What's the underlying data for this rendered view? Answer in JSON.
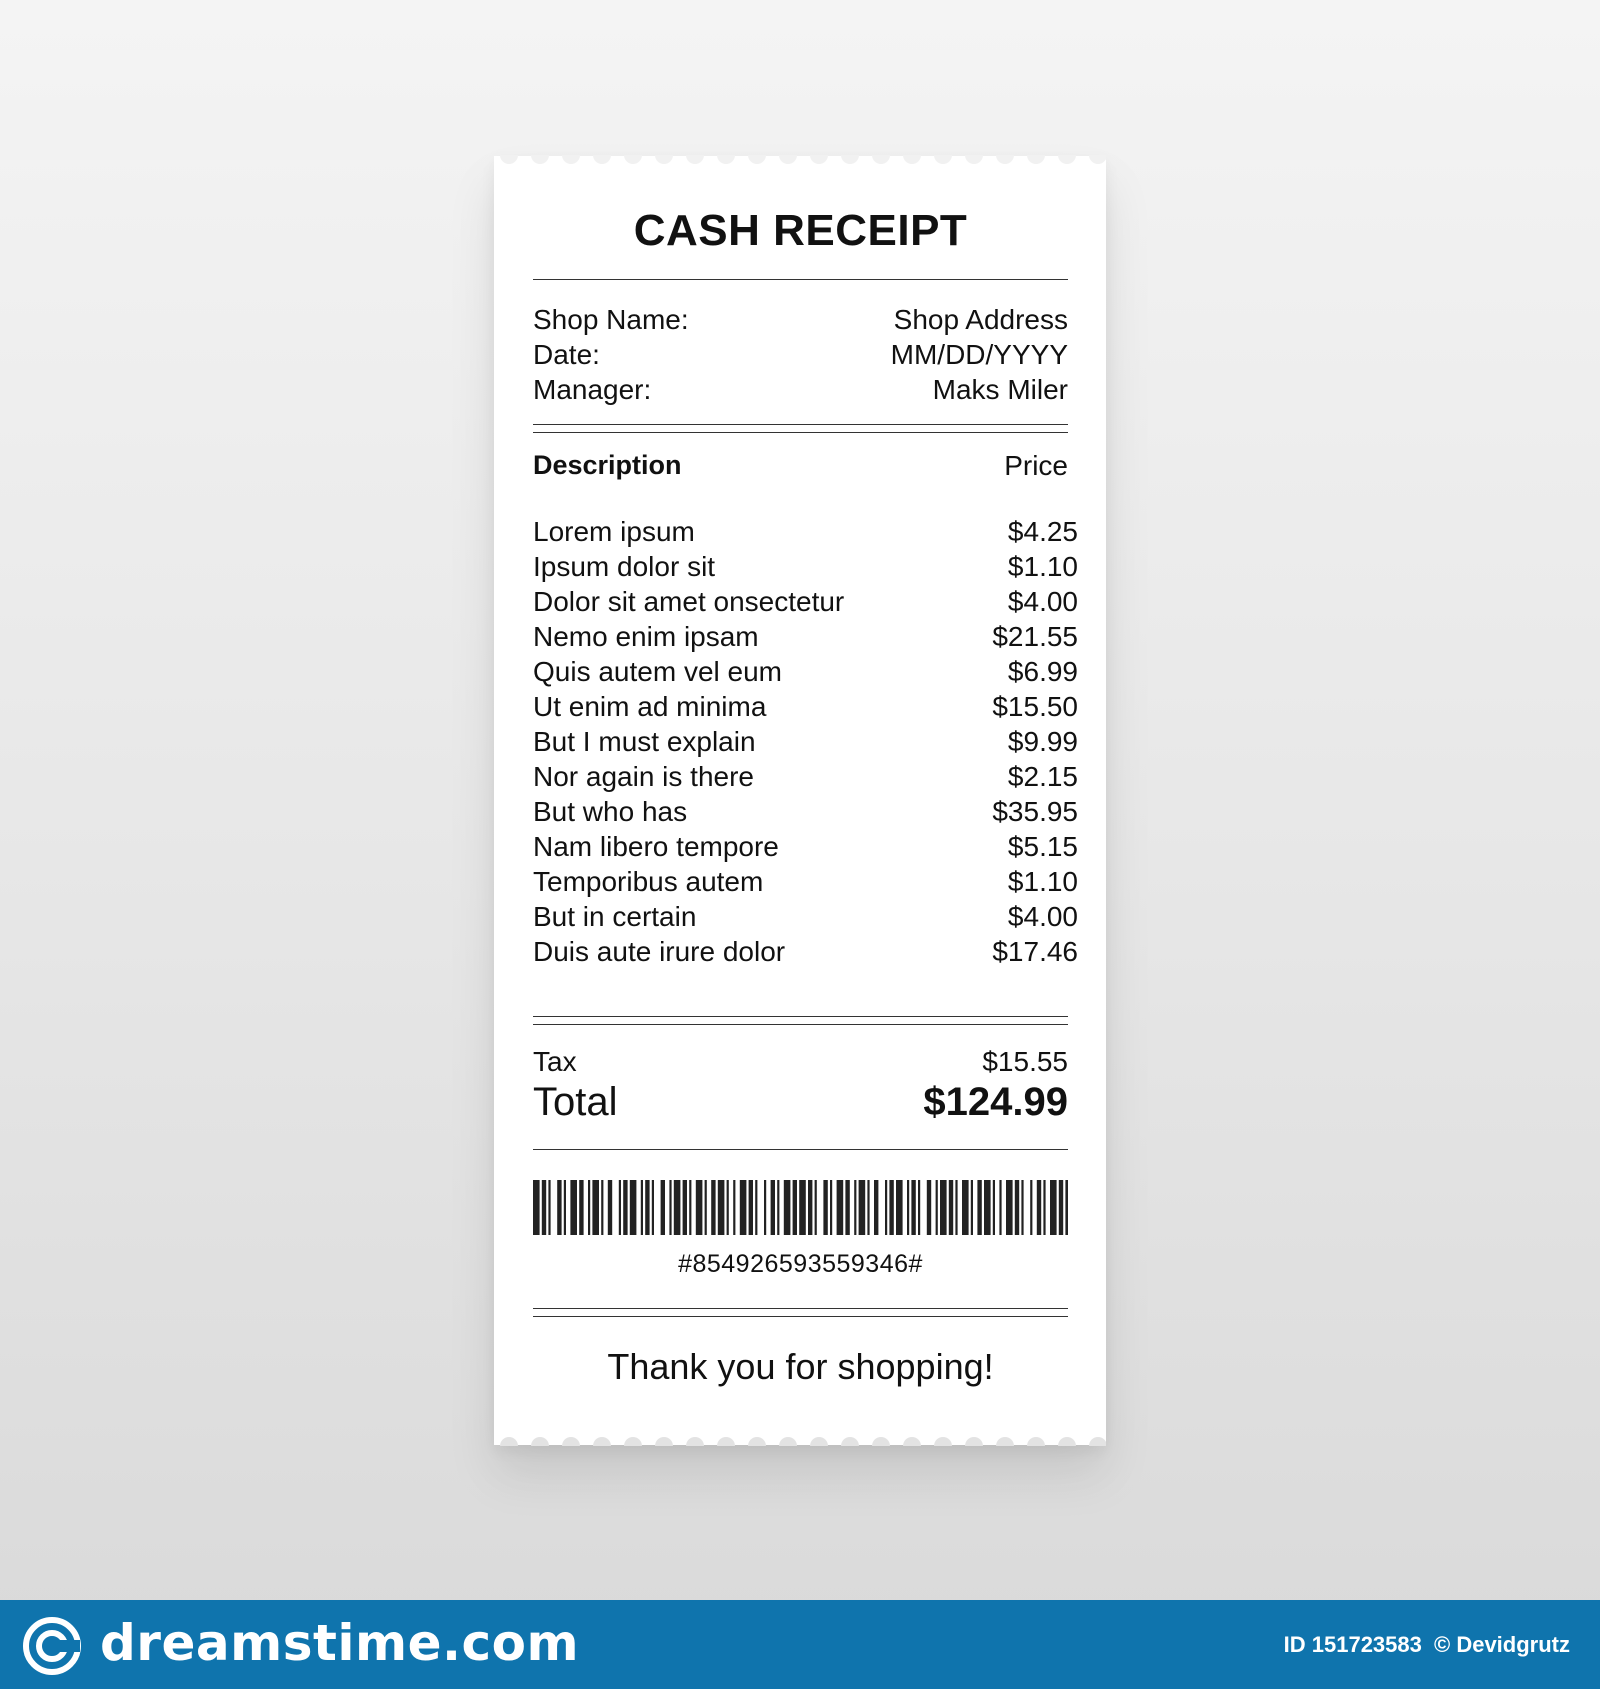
{
  "receipt": {
    "title": "CASH RECEIPT",
    "info": [
      {
        "label": "Shop Name:",
        "value": "Shop Address"
      },
      {
        "label": "Date:",
        "value": "MM/DD/YYYY"
      },
      {
        "label": "Manager:",
        "value": "Maks Miler"
      }
    ],
    "columns": {
      "description": "Description",
      "price": "Price"
    },
    "items": [
      {
        "name": "Lorem ipsum",
        "price": "$4.25"
      },
      {
        "name": "Ipsum dolor sit",
        "price": "$1.10"
      },
      {
        "name": "Dolor sit amet onsectetur",
        "price": "$4.00"
      },
      {
        "name": "Nemo enim ipsam",
        "price": "$21.55"
      },
      {
        "name": "Quis autem vel eum",
        "price": "$6.99"
      },
      {
        "name": "Ut enim ad minima",
        "price": "$15.50"
      },
      {
        "name": "But I must explain",
        "price": "$9.99"
      },
      {
        "name": "Nor again is there",
        "price": "$2.15"
      },
      {
        "name": "But who has",
        "price": "$35.95"
      },
      {
        "name": "Nam libero tempore",
        "price": "$5.15"
      },
      {
        "name": "Temporibus autem",
        "price": "$1.10"
      },
      {
        "name": "But in certain",
        "price": "$4.00"
      },
      {
        "name": "Duis aute irure dolor",
        "price": "$17.46"
      }
    ],
    "tax": {
      "label": "Tax",
      "value": "$15.55"
    },
    "total": {
      "label": "Total",
      "value": "$124.99"
    },
    "barcode_number": "#854926593559346#",
    "thanks": "Thank you for shopping!"
  },
  "footer": {
    "brand": "dreamstime.com",
    "id_label": "ID 151723583",
    "author": "© Devidgrutz",
    "background_color": "#0f74ad"
  }
}
